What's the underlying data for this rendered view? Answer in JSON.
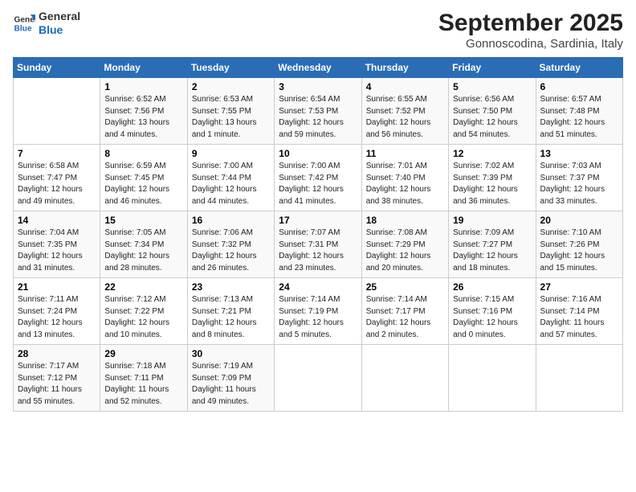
{
  "logo": {
    "line1": "General",
    "line2": "Blue"
  },
  "title": "September 2025",
  "subtitle": "Gonnoscodina, Sardinia, Italy",
  "weekdays": [
    "Sunday",
    "Monday",
    "Tuesday",
    "Wednesday",
    "Thursday",
    "Friday",
    "Saturday"
  ],
  "weeks": [
    [
      {
        "num": "",
        "info": ""
      },
      {
        "num": "1",
        "info": "Sunrise: 6:52 AM\nSunset: 7:56 PM\nDaylight: 13 hours\nand 4 minutes."
      },
      {
        "num": "2",
        "info": "Sunrise: 6:53 AM\nSunset: 7:55 PM\nDaylight: 13 hours\nand 1 minute."
      },
      {
        "num": "3",
        "info": "Sunrise: 6:54 AM\nSunset: 7:53 PM\nDaylight: 12 hours\nand 59 minutes."
      },
      {
        "num": "4",
        "info": "Sunrise: 6:55 AM\nSunset: 7:52 PM\nDaylight: 12 hours\nand 56 minutes."
      },
      {
        "num": "5",
        "info": "Sunrise: 6:56 AM\nSunset: 7:50 PM\nDaylight: 12 hours\nand 54 minutes."
      },
      {
        "num": "6",
        "info": "Sunrise: 6:57 AM\nSunset: 7:48 PM\nDaylight: 12 hours\nand 51 minutes."
      }
    ],
    [
      {
        "num": "7",
        "info": "Sunrise: 6:58 AM\nSunset: 7:47 PM\nDaylight: 12 hours\nand 49 minutes."
      },
      {
        "num": "8",
        "info": "Sunrise: 6:59 AM\nSunset: 7:45 PM\nDaylight: 12 hours\nand 46 minutes."
      },
      {
        "num": "9",
        "info": "Sunrise: 7:00 AM\nSunset: 7:44 PM\nDaylight: 12 hours\nand 44 minutes."
      },
      {
        "num": "10",
        "info": "Sunrise: 7:00 AM\nSunset: 7:42 PM\nDaylight: 12 hours\nand 41 minutes."
      },
      {
        "num": "11",
        "info": "Sunrise: 7:01 AM\nSunset: 7:40 PM\nDaylight: 12 hours\nand 38 minutes."
      },
      {
        "num": "12",
        "info": "Sunrise: 7:02 AM\nSunset: 7:39 PM\nDaylight: 12 hours\nand 36 minutes."
      },
      {
        "num": "13",
        "info": "Sunrise: 7:03 AM\nSunset: 7:37 PM\nDaylight: 12 hours\nand 33 minutes."
      }
    ],
    [
      {
        "num": "14",
        "info": "Sunrise: 7:04 AM\nSunset: 7:35 PM\nDaylight: 12 hours\nand 31 minutes."
      },
      {
        "num": "15",
        "info": "Sunrise: 7:05 AM\nSunset: 7:34 PM\nDaylight: 12 hours\nand 28 minutes."
      },
      {
        "num": "16",
        "info": "Sunrise: 7:06 AM\nSunset: 7:32 PM\nDaylight: 12 hours\nand 26 minutes."
      },
      {
        "num": "17",
        "info": "Sunrise: 7:07 AM\nSunset: 7:31 PM\nDaylight: 12 hours\nand 23 minutes."
      },
      {
        "num": "18",
        "info": "Sunrise: 7:08 AM\nSunset: 7:29 PM\nDaylight: 12 hours\nand 20 minutes."
      },
      {
        "num": "19",
        "info": "Sunrise: 7:09 AM\nSunset: 7:27 PM\nDaylight: 12 hours\nand 18 minutes."
      },
      {
        "num": "20",
        "info": "Sunrise: 7:10 AM\nSunset: 7:26 PM\nDaylight: 12 hours\nand 15 minutes."
      }
    ],
    [
      {
        "num": "21",
        "info": "Sunrise: 7:11 AM\nSunset: 7:24 PM\nDaylight: 12 hours\nand 13 minutes."
      },
      {
        "num": "22",
        "info": "Sunrise: 7:12 AM\nSunset: 7:22 PM\nDaylight: 12 hours\nand 10 minutes."
      },
      {
        "num": "23",
        "info": "Sunrise: 7:13 AM\nSunset: 7:21 PM\nDaylight: 12 hours\nand 8 minutes."
      },
      {
        "num": "24",
        "info": "Sunrise: 7:14 AM\nSunset: 7:19 PM\nDaylight: 12 hours\nand 5 minutes."
      },
      {
        "num": "25",
        "info": "Sunrise: 7:14 AM\nSunset: 7:17 PM\nDaylight: 12 hours\nand 2 minutes."
      },
      {
        "num": "26",
        "info": "Sunrise: 7:15 AM\nSunset: 7:16 PM\nDaylight: 12 hours\nand 0 minutes."
      },
      {
        "num": "27",
        "info": "Sunrise: 7:16 AM\nSunset: 7:14 PM\nDaylight: 11 hours\nand 57 minutes."
      }
    ],
    [
      {
        "num": "28",
        "info": "Sunrise: 7:17 AM\nSunset: 7:12 PM\nDaylight: 11 hours\nand 55 minutes."
      },
      {
        "num": "29",
        "info": "Sunrise: 7:18 AM\nSunset: 7:11 PM\nDaylight: 11 hours\nand 52 minutes."
      },
      {
        "num": "30",
        "info": "Sunrise: 7:19 AM\nSunset: 7:09 PM\nDaylight: 11 hours\nand 49 minutes."
      },
      {
        "num": "",
        "info": ""
      },
      {
        "num": "",
        "info": ""
      },
      {
        "num": "",
        "info": ""
      },
      {
        "num": "",
        "info": ""
      }
    ]
  ]
}
